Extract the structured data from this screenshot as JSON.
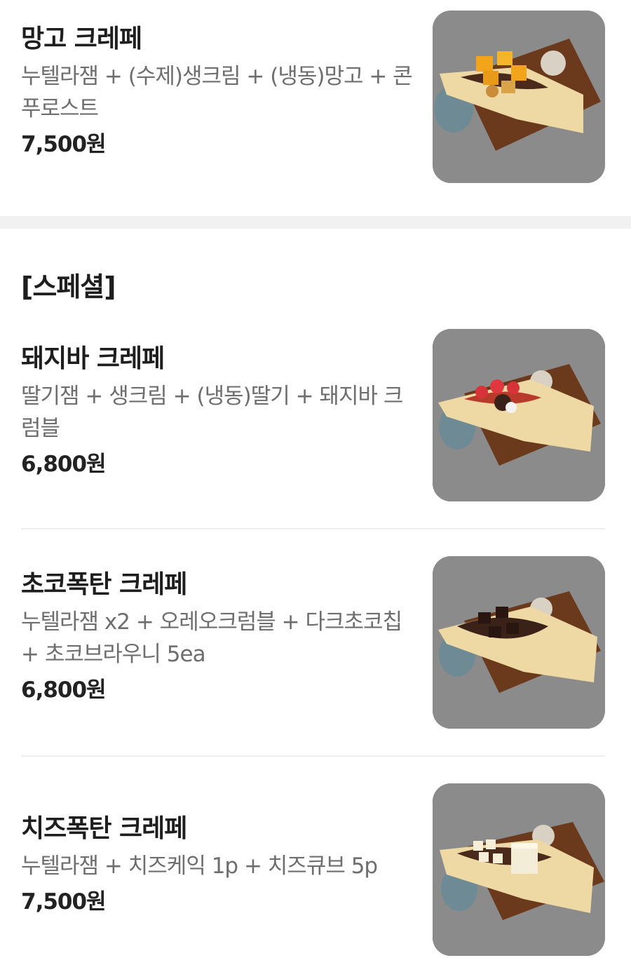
{
  "sections": [
    {
      "items": [
        {
          "name": "망고 크레페",
          "description": "누텔라잼 + (수제)생크림 + (냉동)망고 + 콘푸로스트",
          "price": "7,500원",
          "image_alt": "mango crepe photo"
        }
      ]
    },
    {
      "title": "[스페셜]",
      "items": [
        {
          "name": "돼지바 크레페",
          "description": "딸기잼 + 생크림 + (냉동)딸기 + 돼지바 크럼블",
          "price": "6,800원",
          "image_alt": "strawberry crepe photo"
        },
        {
          "name": "초코폭탄 크레페",
          "description": "누텔라잼 x2 + 오레오크럼블 + 다크초코칩 + 초코브라우니 5ea",
          "price": "6,800원",
          "image_alt": "chocolate crepe photo"
        },
        {
          "name": "치즈폭탄 크레페",
          "description": "누텔라잼 + 치즈케익 1p + 치즈큐브 5p",
          "price": "7,500원",
          "image_alt": "cheese crepe photo"
        }
      ]
    }
  ],
  "colors": {
    "name": "#1e1e1e",
    "description": "#6e6e6e",
    "price": "#222222",
    "section_gap": "#f1f1f1",
    "divider": "#eeeeee"
  }
}
